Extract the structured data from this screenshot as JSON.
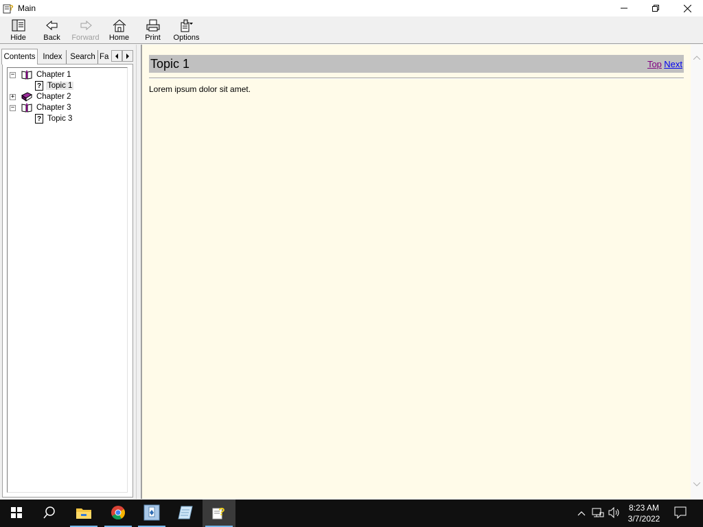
{
  "window": {
    "title": "Main"
  },
  "toolbar": {
    "hide": "Hide",
    "back": "Back",
    "forward": "Forward",
    "home": "Home",
    "print": "Print",
    "options": "Options"
  },
  "nav_tabs": [
    "Contents",
    "Index",
    "Search",
    "Fa"
  ],
  "tree": {
    "items": [
      {
        "label": "Chapter 1",
        "type": "open-book",
        "expander": "−"
      },
      {
        "label": "Topic 1",
        "type": "topic",
        "selected": true
      },
      {
        "label": "Chapter 2",
        "type": "closed-book",
        "expander": "+"
      },
      {
        "label": "Chapter 3",
        "type": "open-book",
        "expander": "−"
      },
      {
        "label": "Topic 3",
        "type": "topic"
      }
    ]
  },
  "content": {
    "title": "Topic 1",
    "link_top": "Top",
    "link_next": "Next",
    "body": "Lorem ipsum dolor sit amet."
  },
  "taskbar": {
    "time": "8:23 AM",
    "date": "3/7/2022",
    "apps": [
      "start-icon",
      "search-icon",
      "file-explorer-icon",
      "chrome-icon",
      "setup-icon",
      "notepad-icon",
      "help-icon"
    ]
  },
  "colors": {
    "content_bg": "#fffbe9",
    "header_bg": "#c0c0c0",
    "link_visited": "#800080",
    "link": "#0000ee",
    "taskbar_bg": "#101010"
  }
}
